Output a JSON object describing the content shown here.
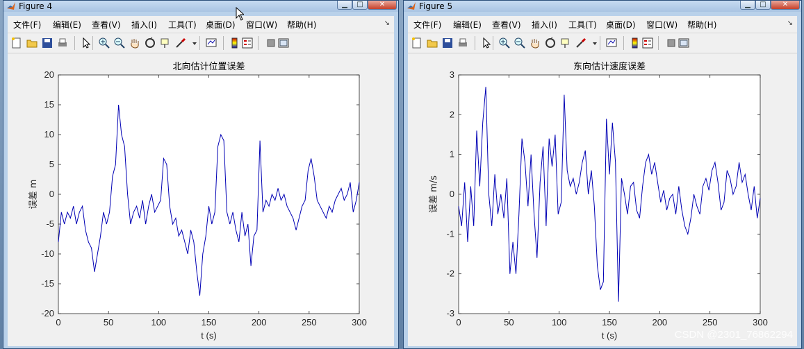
{
  "windows": [
    {
      "id": "fig4",
      "title": "Figure 4",
      "menu": [
        "文件(F)",
        "编辑(E)",
        "查看(V)",
        "插入(I)",
        "工具(T)",
        "桌面(D)",
        "窗口(W)",
        "帮助(H)"
      ],
      "toolbar_icons": [
        "new-figure-icon",
        "open-file-icon",
        "save-icon",
        "print-icon",
        "pointer-icon",
        "zoom-in-icon",
        "zoom-out-icon",
        "pan-hand-icon",
        "rotate-3d-icon",
        "data-cursor-icon",
        "brush-icon",
        "brush-dropdown-icon",
        "link-plot-icon",
        "colorbar-icon",
        "legend-icon",
        "hide-plot-tools-icon",
        "show-plot-tools-icon"
      ],
      "chart_data": {
        "type": "line",
        "title": "北向估计位置误差",
        "xlabel": "t (s)",
        "ylabel": "误差 m",
        "xlim": [
          0,
          300
        ],
        "ylim": [
          -20,
          20
        ],
        "xticks": [
          0,
          50,
          100,
          150,
          200,
          250,
          300
        ],
        "yticks": [
          20,
          15,
          10,
          5,
          0,
          -5,
          -10,
          -15,
          -20
        ],
        "grid": false,
        "series": [
          {
            "color": "#0000b4",
            "x": [
              0,
              3,
              6,
              9,
              12,
              15,
              18,
              21,
              24,
              27,
              30,
              33,
              36,
              39,
              42,
              45,
              48,
              51,
              54,
              57,
              60,
              63,
              66,
              69,
              72,
              75,
              78,
              81,
              84,
              87,
              90,
              93,
              96,
              99,
              102,
              105,
              108,
              111,
              114,
              117,
              120,
              123,
              126,
              129,
              132,
              135,
              138,
              141,
              144,
              147,
              150,
              153,
              156,
              159,
              162,
              165,
              168,
              171,
              174,
              177,
              180,
              183,
              186,
              189,
              192,
              195,
              198,
              201,
              204,
              207,
              210,
              213,
              216,
              219,
              222,
              225,
              228,
              231,
              234,
              237,
              240,
              243,
              246,
              249,
              252,
              255,
              258,
              261,
              264,
              267,
              270,
              273,
              276,
              279,
              282,
              285,
              288,
              291,
              294,
              297,
              300
            ],
            "y": [
              -8,
              -3,
              -5,
              -3,
              -4,
              -2,
              -5,
              -3,
              -2,
              -6,
              -8,
              -9,
              -13,
              -10,
              -7,
              -3,
              -5,
              -3,
              3,
              5,
              15,
              10,
              8,
              0,
              -5,
              -3,
              -2,
              -4,
              -1,
              -5,
              -2,
              0,
              -3,
              -2,
              -1,
              6,
              5,
              -2,
              -5,
              -4,
              -7,
              -6,
              -8,
              -10,
              -6,
              -8,
              -13,
              -17,
              -10,
              -7,
              -2,
              -5,
              -3,
              8,
              10,
              9,
              -3,
              -5,
              -3,
              -6,
              -8,
              -3,
              -7,
              -5,
              -12,
              -7,
              -6,
              9,
              -3,
              -1,
              -2,
              0,
              -1,
              1,
              -1,
              0,
              -2,
              -3,
              -4,
              -6,
              -4,
              -2,
              -1,
              4,
              6,
              3,
              -1,
              -2,
              -3,
              -4,
              -2,
              -3,
              -1,
              0,
              1,
              -1,
              0,
              2,
              -3,
              -1,
              2
            ]
          }
        ]
      }
    },
    {
      "id": "fig5",
      "title": "Figure 5",
      "menu": [
        "文件(F)",
        "编辑(E)",
        "查看(V)",
        "插入(I)",
        "工具(T)",
        "桌面(D)",
        "窗口(W)",
        "帮助(H)"
      ],
      "toolbar_icons": [
        "new-figure-icon",
        "open-file-icon",
        "save-icon",
        "print-icon",
        "pointer-icon",
        "zoom-in-icon",
        "zoom-out-icon",
        "pan-hand-icon",
        "rotate-3d-icon",
        "data-cursor-icon",
        "brush-icon",
        "brush-dropdown-icon",
        "link-plot-icon",
        "colorbar-icon",
        "legend-icon",
        "hide-plot-tools-icon",
        "show-plot-tools-icon"
      ],
      "chart_data": {
        "type": "line",
        "title": "东向估计速度误差",
        "xlabel": "t (s)",
        "ylabel": "误差 m/s",
        "xlim": [
          0,
          300
        ],
        "ylim": [
          -3,
          3
        ],
        "xticks": [
          0,
          50,
          100,
          150,
          200,
          250,
          300
        ],
        "yticks": [
          3,
          2,
          1,
          0,
          -1,
          -2,
          -3
        ],
        "grid": false,
        "series": [
          {
            "color": "#0000b4",
            "x": [
              0,
              3,
              6,
              9,
              12,
              15,
              18,
              21,
              24,
              27,
              30,
              33,
              36,
              39,
              42,
              45,
              48,
              51,
              54,
              57,
              60,
              63,
              66,
              69,
              72,
              75,
              78,
              81,
              84,
              87,
              90,
              93,
              96,
              99,
              102,
              105,
              108,
              111,
              114,
              117,
              120,
              123,
              126,
              129,
              132,
              135,
              138,
              141,
              144,
              147,
              150,
              153,
              156,
              159,
              162,
              165,
              168,
              171,
              174,
              177,
              180,
              183,
              186,
              189,
              192,
              195,
              198,
              201,
              204,
              207,
              210,
              213,
              216,
              219,
              222,
              225,
              228,
              231,
              234,
              237,
              240,
              243,
              246,
              249,
              252,
              255,
              258,
              261,
              264,
              267,
              270,
              273,
              276,
              279,
              282,
              285,
              288,
              291,
              294,
              297,
              300
            ],
            "y": [
              -0.3,
              -0.8,
              0.3,
              -1.2,
              0.2,
              -0.8,
              1.6,
              0.2,
              1.8,
              2.7,
              0.0,
              -0.8,
              0.5,
              -0.5,
              0.0,
              -0.6,
              0.4,
              -2.0,
              -1.2,
              -2.0,
              -0.5,
              1.4,
              0.8,
              -0.3,
              1.0,
              -0.5,
              -1.6,
              0.3,
              1.2,
              -0.8,
              1.4,
              0.7,
              1.5,
              -0.5,
              -0.2,
              2.5,
              0.6,
              0.2,
              0.4,
              0.0,
              0.3,
              0.8,
              1.1,
              0.0,
              0.6,
              -0.3,
              -1.8,
              -2.4,
              -2.2,
              1.9,
              0.5,
              1.8,
              0.8,
              -2.7,
              0.4,
              0.0,
              -0.5,
              0.2,
              0.3,
              -0.4,
              -0.6,
              0.2,
              0.8,
              1.0,
              0.5,
              0.8,
              0.3,
              -0.2,
              0.1,
              -0.4,
              -0.1,
              0.0,
              -0.5,
              0.2,
              -0.4,
              -0.8,
              -1.0,
              -0.6,
              0.0,
              -0.3,
              -0.5,
              0.2,
              0.4,
              0.1,
              0.6,
              0.8,
              0.3,
              -0.4,
              -0.2,
              0.6,
              0.4,
              0.0,
              0.2,
              0.8,
              0.3,
              0.5,
              0.0,
              -0.4,
              0.2,
              -0.6,
              -0.1
            ]
          }
        ]
      }
    }
  ],
  "watermark": "CSDN @2301_76862294"
}
